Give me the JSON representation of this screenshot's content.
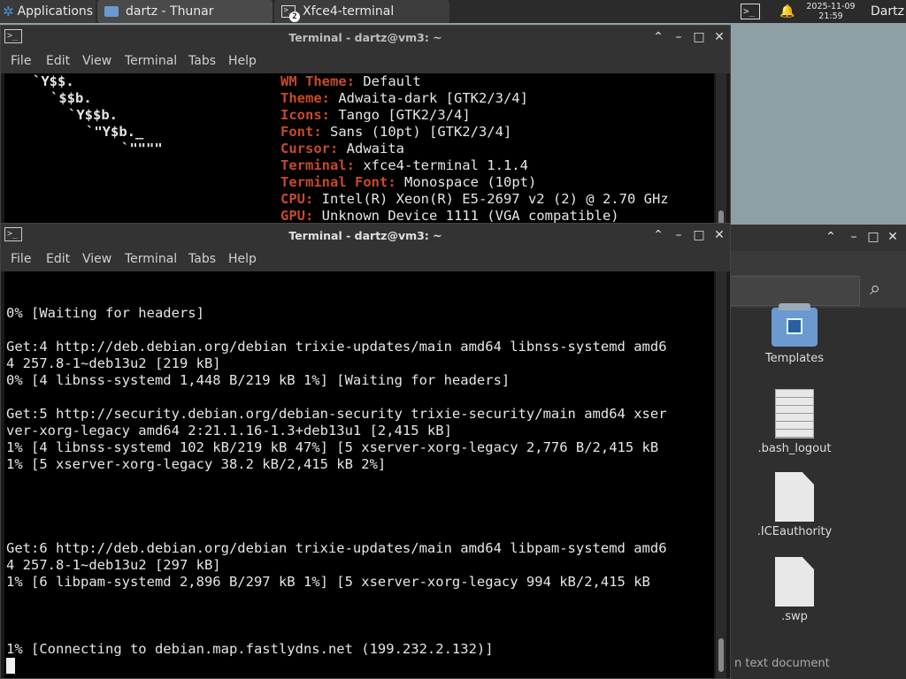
{
  "panel": {
    "applications_label": "Applications",
    "tasks": [
      {
        "label": "dartz - Thunar",
        "icon": "folder-icon"
      },
      {
        "label": "Xfce4-terminal",
        "icon": "terminal-icon",
        "badge": "2"
      }
    ],
    "clock_date": "2025-11-09",
    "clock_time": "21:59",
    "user": "Dartz"
  },
  "terminal_back": {
    "title": "Terminal - dartz@vm3: ~",
    "menu": [
      "File",
      "Edit",
      "View",
      "Terminal",
      "Tabs",
      "Help"
    ],
    "logo_lines": [
      "`Y$$.",
      "`$$b.",
      "`Y$$b.",
      "`\"Y$b._",
      "`\"\"\"\""
    ],
    "info": [
      {
        "key": "WM Theme",
        "value": "Default"
      },
      {
        "key": "Theme",
        "value": "Adwaita-dark [GTK2/3/4]"
      },
      {
        "key": "Icons",
        "value": "Tango [GTK2/3/4]"
      },
      {
        "key": "Font",
        "value": "Sans (10pt) [GTK2/3/4]"
      },
      {
        "key": "Cursor",
        "value": "Adwaita"
      },
      {
        "key": "Terminal",
        "value": "xfce4-terminal 1.1.4"
      },
      {
        "key": "Terminal Font",
        "value": "Monospace (10pt)"
      },
      {
        "key": "CPU",
        "value": "Intel(R) Xeon(R) E5-2697 v2 (2) @ 2.70 GHz"
      },
      {
        "key": "GPU",
        "value": "Unknown Device 1111 (VGA compatible)"
      }
    ]
  },
  "terminal_front": {
    "title": "Terminal - dartz@vm3: ~",
    "menu": [
      "File",
      "Edit",
      "View",
      "Terminal",
      "Tabs",
      "Help"
    ],
    "lines": [
      {
        "text": "0% [Waiting for headers]",
        "style": "orange"
      },
      {
        "text": "",
        "style": "white"
      },
      {
        "text": "Get:4 http://deb.debian.org/debian trixie-updates/main amd64 libnss-systemd amd6",
        "style": "white"
      },
      {
        "text": "4 257.8-1~deb13u2 [219 kB]",
        "style": "white"
      },
      {
        "text": "0% [4 libnss-systemd 1,448 B/219 kB 1%] [Waiting for headers]",
        "style": "orange"
      },
      {
        "text": "",
        "style": "white"
      },
      {
        "text": "Get:5 http://security.debian.org/debian-security trixie-security/main amd64 xser",
        "style": "white"
      },
      {
        "text": "ver-xorg-legacy amd64 2:21.1.16-1.3+deb13u1 [2,415 kB]",
        "style": "white"
      },
      {
        "text": "1% [4 libnss-systemd 102 kB/219 kB 47%] [5 xserver-xorg-legacy 2,776 B/2,415 kB",
        "style": "orange"
      },
      {
        "text": "1% [5 xserver-xorg-legacy 38.2 kB/2,415 kB 2%]",
        "style": "orange"
      },
      {
        "text": "",
        "style": "white"
      },
      {
        "text": "",
        "style": "white"
      },
      {
        "text": "",
        "style": "white"
      },
      {
        "text": "",
        "style": "white"
      },
      {
        "text": "Get:6 http://deb.debian.org/debian trixie-updates/main amd64 libpam-systemd amd6",
        "style": "white"
      },
      {
        "text": "4 257.8-1~deb13u2 [297 kB]",
        "style": "white"
      },
      {
        "text": "1% [6 libpam-systemd 2,896 B/297 kB 1%] [5 xserver-xorg-legacy 994 kB/2,415 kB",
        "style": "orange"
      },
      {
        "text": "",
        "style": "white"
      },
      {
        "text": "",
        "style": "white"
      },
      {
        "text": "",
        "style": "white"
      },
      {
        "text": "1% [Connecting to debian.map.fastlydns.net (199.232.2.132)]",
        "style": "orange"
      }
    ]
  },
  "thunar": {
    "files": [
      {
        "name": "Templates",
        "icon": "folder-templates-icon"
      },
      {
        "name": ".bash_logout",
        "icon": "text-document-icon"
      },
      {
        "name": ".ICEauthority",
        "icon": "blank-document-icon"
      },
      {
        "name": ".swp",
        "icon": "blank-document-icon"
      }
    ],
    "status": "n text document"
  }
}
